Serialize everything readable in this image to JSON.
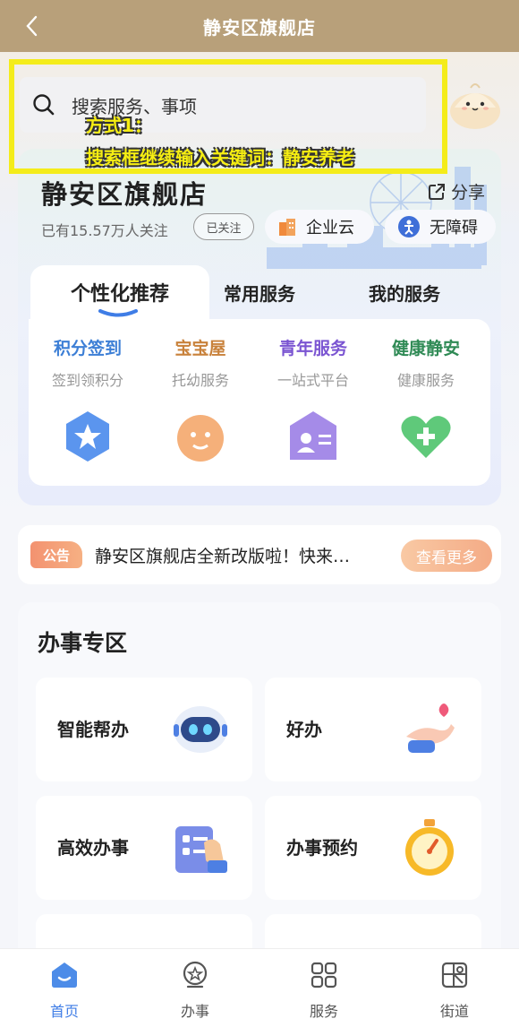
{
  "header": {
    "title": "静安区旗舰店",
    "back_icon": "chevron-left-icon"
  },
  "search": {
    "placeholder": "搜索服务、事项"
  },
  "annotation": {
    "line1": "方式1：",
    "line2": "搜索框继续输入关键词：静安养老",
    "color": "#f4ec1a"
  },
  "store": {
    "title": "静安区旗舰店",
    "share_label": "分享",
    "followers": "已有15.57万人关注",
    "followed_label": "已关注",
    "pills": [
      {
        "label": "企业云"
      },
      {
        "label": "无障碍"
      }
    ]
  },
  "tabs": [
    {
      "label": "个性化推荐"
    },
    {
      "label": "常用服务"
    },
    {
      "label": "我的服务"
    }
  ],
  "services": [
    {
      "title": "积分签到",
      "subtitle": "签到领积分",
      "color": "#3d7fd6",
      "icon": "star-badge-icon"
    },
    {
      "title": "宝宝屋",
      "subtitle": "托幼服务",
      "color": "#c8813a",
      "icon": "baby-face-icon"
    },
    {
      "title": "青年服务",
      "subtitle": "一站式平台",
      "color": "#7b55d2",
      "icon": "id-card-icon"
    },
    {
      "title": "健康静安",
      "subtitle": "健康服务",
      "color": "#2f8a55",
      "icon": "health-heart-icon"
    }
  ],
  "notice": {
    "tag": "公告",
    "message": "静安区旗舰店全新改版啦！快来…",
    "more_label": "查看更多"
  },
  "affairs": {
    "title": "办事专区",
    "cards": [
      {
        "label": "智能帮办",
        "icon": "robot-icon"
      },
      {
        "label": "好办",
        "icon": "hand-heart-icon"
      },
      {
        "label": "高效办事",
        "icon": "checklist-icon"
      },
      {
        "label": "办事预约",
        "icon": "stopwatch-icon"
      }
    ]
  },
  "bottom_nav": [
    {
      "label": "首页",
      "icon": "home-icon",
      "active": true
    },
    {
      "label": "办事",
      "icon": "affairs-icon",
      "active": false
    },
    {
      "label": "服务",
      "icon": "grid-icon",
      "active": false
    },
    {
      "label": "街道",
      "icon": "street-map-icon",
      "active": false
    }
  ],
  "colors": {
    "header_bg": "#b8a07a",
    "accent_blue": "#3f7de6",
    "notice_orange": "#f39270"
  }
}
